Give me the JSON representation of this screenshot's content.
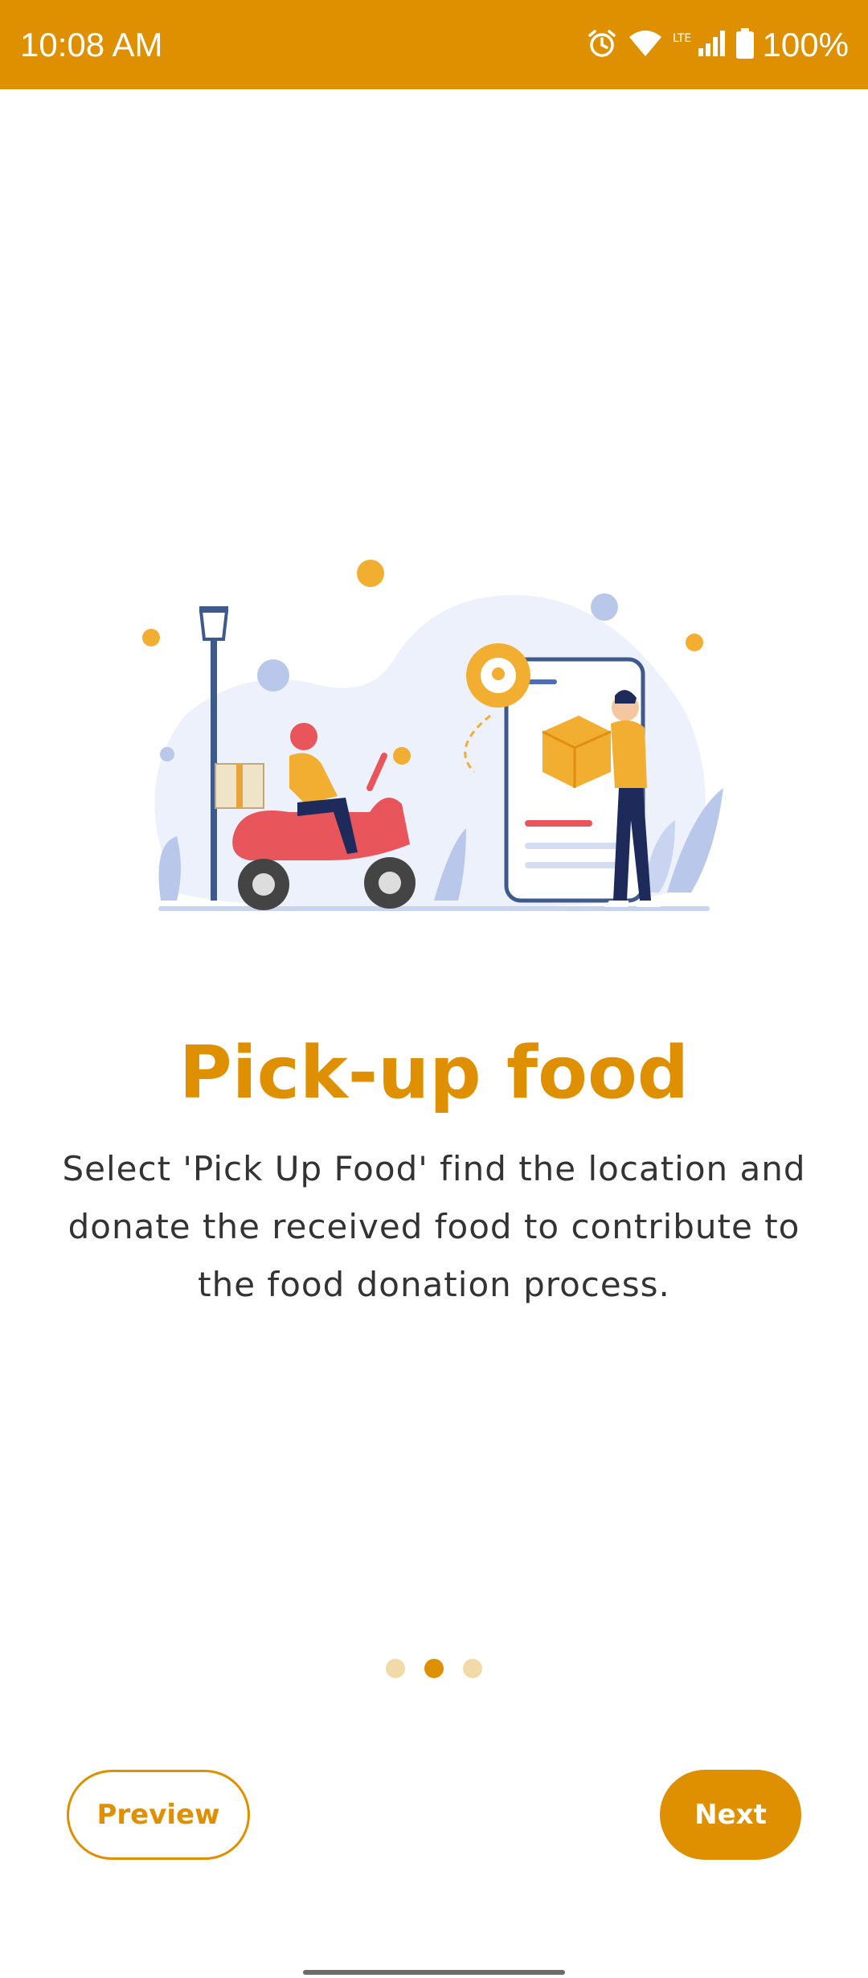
{
  "status_bar": {
    "time": "10:08 AM",
    "battery_percent": "100%",
    "icons": [
      "alarm-icon",
      "wifi-icon",
      "lte-signal-icon",
      "battery-icon"
    ],
    "background_color": "#DF9000"
  },
  "onboarding": {
    "title": "Pick-up food",
    "description": "Select 'Pick Up Food' find the location and donate the received food to contribute to the food donation process.",
    "illustration": "delivery-scooter-and-phone-illustration",
    "page_indicator": {
      "total": 3,
      "active_index": 1
    }
  },
  "buttons": {
    "preview_label": "Preview",
    "next_label": "Next"
  },
  "colors": {
    "accent": "#DF9000",
    "dot_inactive": "#F2D9A8",
    "text": "#333333"
  }
}
